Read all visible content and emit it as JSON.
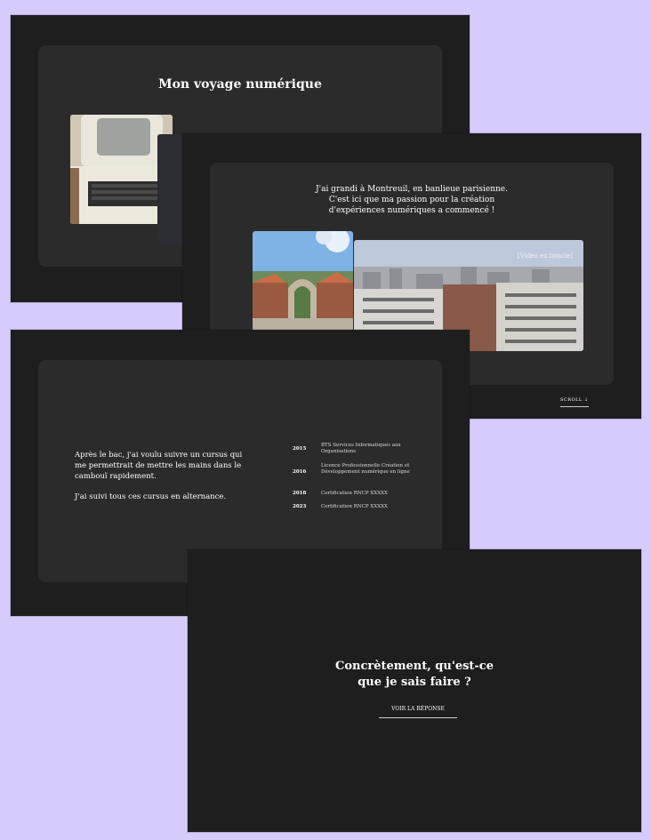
{
  "slide1": {
    "title": "Mon voyage numérique"
  },
  "slide2": {
    "lead": "J'ai grandi à Montreuil, en banlieue parisienne. C'est ici que ma passion pour la création d'expériences numériques a commencé !",
    "video_note": "[Vidéo en boucle]",
    "scroll_label": "SCROLL ↓"
  },
  "slide3": {
    "paragraph1": "Après le bac, j'ai voulu suivre un cursus qui me permettrait de mettre les mains dans le cambouï rapidement.",
    "paragraph2": "J'ai suivi tous ces cursus en alternance.",
    "timeline": [
      {
        "year": "2015",
        "text": "BTS Services Informatiques aux Organisations"
      },
      {
        "year": "2016",
        "text": "Licence Professionnelle Création et Développement numérique en ligne"
      },
      {
        "year": "2018",
        "text": "Certification RNCP XXXXX"
      },
      {
        "year": "2023",
        "text": "Certification RNCP XXXXX"
      }
    ]
  },
  "slide4": {
    "question": "Concrètement, qu'est-ce que je sais faire ?",
    "cta": "VOIR LA RÉPONSE"
  },
  "colors": {
    "background": "#d7cbfb",
    "slide": "#1e1e1f",
    "panel": "#2b2b2c"
  }
}
